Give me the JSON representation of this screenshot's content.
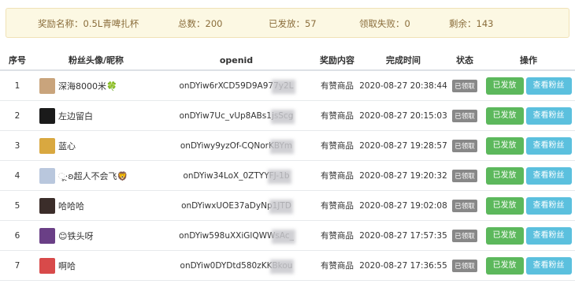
{
  "summary": {
    "name": "奖励名称：0.5L青啤扎杯",
    "total": "总数：200",
    "sent": "已发放：57",
    "failed": "领取失败：0",
    "left": "剩余：143"
  },
  "columns": [
    "序号",
    "粉丝头像/昵称",
    "openid",
    "奖励内容",
    "完成时间",
    "状态",
    "操作"
  ],
  "rows": [
    {
      "index": "1",
      "nickname": "深海8000米🍀",
      "openid": "onDYiw6rXCD59D9A977y2L",
      "reward": "有赞商品",
      "time": "2020-08-27 20:38:44",
      "status": "已领取",
      "sent_label": "已发放",
      "view_label": "查看粉丝",
      "avatar_color": "#c9a47c"
    },
    {
      "index": "2",
      "nickname": "左边留白",
      "openid": "onDYiw7Uc_vUp8ABs1jsScg",
      "reward": "有赞商品",
      "time": "2020-08-27 20:15:03",
      "status": "已领取",
      "sent_label": "已发放",
      "view_label": "查看粉丝",
      "avatar_color": "#1a1a1a"
    },
    {
      "index": "3",
      "nickname": "蓝心",
      "openid": "onDYiwy9yzOf-CQNorKBYm",
      "reward": "有赞商品",
      "time": "2020-08-27 19:28:57",
      "status": "已领取",
      "sent_label": "已发放",
      "view_label": "查看粉丝",
      "avatar_color": "#d9a840"
    },
    {
      "index": "4",
      "nickname": "ૂ·ʚ超人不会飞🦁",
      "openid": "onDYiw34LoX_0ZTYYFJ-1b",
      "reward": "有赞商品",
      "time": "2020-08-27 19:20:32",
      "status": "已领取",
      "sent_label": "已发放",
      "view_label": "查看粉丝",
      "avatar_color": "#b9c7dd"
    },
    {
      "index": "5",
      "nickname": "哈哈哈",
      "openid": "onDYiwxUOE37aDyNp1JTD",
      "reward": "有赞商品",
      "time": "2020-08-27 19:02:08",
      "status": "已领取",
      "sent_label": "已发放",
      "view_label": "查看粉丝",
      "avatar_color": "#3b2d2a"
    },
    {
      "index": "6",
      "nickname": "😊铁头呀",
      "openid": "onDYiw598uXXiGlQWWsAc_",
      "reward": "有赞商品",
      "time": "2020-08-27 17:57:35",
      "status": "已领取",
      "sent_label": "已发放",
      "view_label": "查看粉丝",
      "avatar_color": "#6a3f86"
    },
    {
      "index": "7",
      "nickname": "啊哈",
      "openid": "onDYiw0DYDtd580zKKBkou",
      "reward": "有赞商品",
      "time": "2020-08-27 17:36:55",
      "status": "已领取",
      "sent_label": "已发放",
      "view_label": "查看粉丝",
      "avatar_color": "#d84a4a"
    }
  ]
}
